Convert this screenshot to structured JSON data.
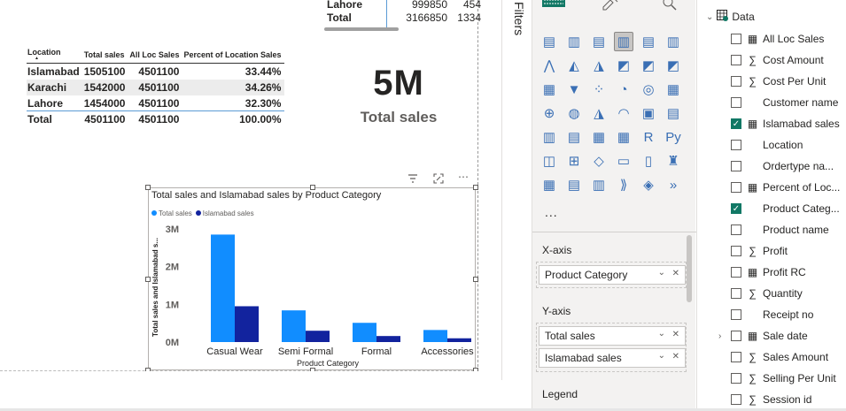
{
  "top_table": {
    "partial_row": {
      "label": "Lahore",
      "v1": "999850",
      "v2": "454"
    },
    "total_row": {
      "label": "Total",
      "v1": "3166850",
      "v2": "1334"
    }
  },
  "location_table": {
    "headers": [
      "Location",
      "Total sales",
      "All Loc Sales",
      "Percent of Location Sales"
    ],
    "rows": [
      [
        "Islamabad",
        "1505100",
        "4501100",
        "33.44%"
      ],
      [
        "Karachi",
        "1542000",
        "4501100",
        "34.26%"
      ],
      [
        "Lahore",
        "1454000",
        "4501100",
        "32.30%"
      ]
    ],
    "total": [
      "Total",
      "4501100",
      "4501100",
      "100.00%"
    ]
  },
  "card": {
    "value": "5M",
    "label": "Total sales"
  },
  "visual_header_icons": [
    "filter-icon",
    "focus-mode-icon",
    "more-options-icon"
  ],
  "chart_data": {
    "type": "bar",
    "title": "Total sales and Islamabad sales by Product Category",
    "xlabel": "Product Category",
    "ylabel": "Total sales and Islamabad s...",
    "categories": [
      "Casual Wear",
      "Semi Formal",
      "Formal",
      "Accessories"
    ],
    "series": [
      {
        "name": "Total sales",
        "color": "#118dff",
        "values": [
          2850000,
          840000,
          510000,
          320000
        ]
      },
      {
        "name": "Islamabad sales",
        "color": "#12239e",
        "values": [
          950000,
          300000,
          160000,
          100000
        ]
      }
    ],
    "yticks": [
      "0M",
      "1M",
      "2M",
      "3M"
    ],
    "ylim": [
      0,
      3000000
    ],
    "legend_position": "top-left"
  },
  "filters_label": "Filters",
  "viz_pane": {
    "tabs": [
      "build-visual-icon",
      "format-visual-icon",
      "analytics-icon"
    ],
    "more": "...",
    "x_axis_label": "X-axis",
    "x_axis_fields": [
      "Product Category"
    ],
    "y_axis_label": "Y-axis",
    "y_axis_fields": [
      "Total sales",
      "Islamabad sales"
    ],
    "legend_label": "Legend"
  },
  "data_pane": {
    "root": "Data",
    "fields": [
      {
        "name": "All Loc Sales",
        "type": "calc",
        "checked": false
      },
      {
        "name": "Cost Amount",
        "type": "sum",
        "checked": false
      },
      {
        "name": "Cost Per Unit",
        "type": "sum",
        "checked": false
      },
      {
        "name": "Customer name",
        "type": "none",
        "checked": false
      },
      {
        "name": "Islamabad sales",
        "type": "calc",
        "checked": true
      },
      {
        "name": "Location",
        "type": "none",
        "checked": false
      },
      {
        "name": "Ordertype na...",
        "type": "none",
        "checked": false
      },
      {
        "name": "Percent of Loc...",
        "type": "calc",
        "checked": false
      },
      {
        "name": "Product Categ...",
        "type": "none",
        "checked": true
      },
      {
        "name": "Product name",
        "type": "none",
        "checked": false
      },
      {
        "name": "Profit",
        "type": "sum",
        "checked": false
      },
      {
        "name": "Profit RC",
        "type": "calc",
        "checked": false
      },
      {
        "name": "Quantity",
        "type": "sum",
        "checked": false
      },
      {
        "name": "Receipt no",
        "type": "none",
        "checked": false
      },
      {
        "name": "Sale date",
        "type": "calendar",
        "checked": false
      },
      {
        "name": "Sales Amount",
        "type": "sum",
        "checked": false
      },
      {
        "name": "Selling Per Unit",
        "type": "sum",
        "checked": false
      },
      {
        "name": "Session id",
        "type": "sum",
        "checked": false
      }
    ]
  }
}
